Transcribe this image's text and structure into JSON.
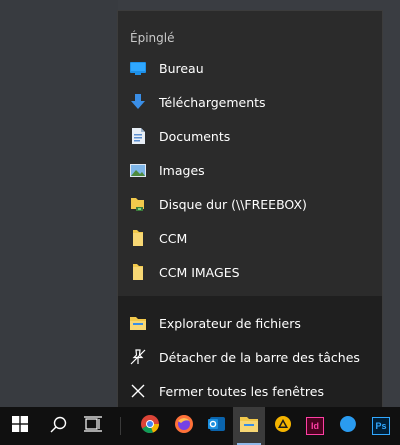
{
  "jumplist": {
    "section_title": "Épinglé",
    "pinned": [
      {
        "label": "Bureau",
        "icon": "desktop-folder-icon"
      },
      {
        "label": "Téléchargements",
        "icon": "download-arrow-icon"
      },
      {
        "label": "Documents",
        "icon": "documents-icon"
      },
      {
        "label": "Images",
        "icon": "pictures-icon"
      },
      {
        "label": "Disque dur (\\\\FREEBOX)",
        "icon": "network-drive-icon"
      },
      {
        "label": "CCM",
        "icon": "folder-icon"
      },
      {
        "label": "CCM IMAGES",
        "icon": "folder-icon"
      }
    ],
    "tasks": [
      {
        "label": "Explorateur de fichiers",
        "icon": "file-explorer-icon"
      },
      {
        "label": "Détacher de la barre des tâches",
        "icon": "unpin-icon"
      },
      {
        "label": "Fermer toutes les fenêtres",
        "icon": "close-icon"
      }
    ]
  },
  "taskbar": {
    "items": [
      {
        "icon": "windows-start-icon"
      },
      {
        "icon": "search-icon"
      },
      {
        "icon": "task-view-icon"
      },
      {
        "icon": "chrome-icon"
      },
      {
        "icon": "firefox-icon"
      },
      {
        "icon": "outlook-icon"
      },
      {
        "icon": "file-explorer-icon",
        "active": true
      },
      {
        "icon": "triangle-app-icon"
      },
      {
        "icon": "indesign-icon",
        "text": "Id"
      },
      {
        "icon": "edge-icon"
      },
      {
        "icon": "photoshop-icon",
        "text": "Ps"
      }
    ]
  },
  "colors": {
    "menu_bg": "#2b2b2b",
    "tasks_bg": "#1f1f1f",
    "taskbar_bg": "#101010",
    "folder_yellow": "#f2c94c",
    "accent_blue": "#3a8ee6",
    "indesign_pink": "#ff3fa4",
    "photoshop_blue": "#31a8ff"
  }
}
